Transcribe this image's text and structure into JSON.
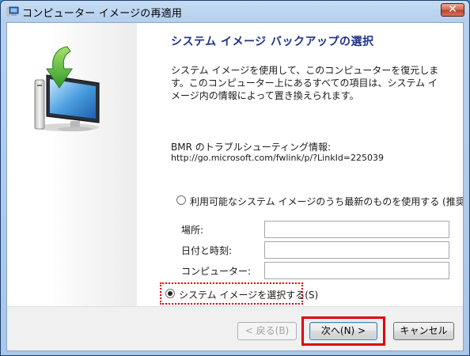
{
  "window": {
    "title": "コンピューター イメージの再適用",
    "close_glyph": "✕"
  },
  "page": {
    "heading": "システム イメージ バックアップの選択",
    "description": "システム イメージを使用して、このコンピューターを復元します。このコンピューター上にあるすべての項目は、システム イメージ内の情報によって置き換えられます。",
    "bmr_label": "BMR のトラブルシューティング情報:",
    "bmr_link": "http://go.microsoft.com/fwlink/p/?LinkId=225039"
  },
  "options": {
    "latest_label": "利用可能なシステム イメージのうち最新のものを使用する (推奨)(U)",
    "latest_selected": false,
    "select_label": "システム イメージを選択する(S)",
    "select_selected": true
  },
  "fields": [
    {
      "label": "場所:",
      "value": ""
    },
    {
      "label": "日付と時刻:",
      "value": ""
    },
    {
      "label": "コンピューター:",
      "value": ""
    }
  ],
  "buttons": {
    "back": "< 戻る(B)",
    "next": "次へ(N) >",
    "cancel": "キャンセル"
  },
  "icons": {
    "title": "restore-image-icon",
    "logo": "computer-restore-arrow-icon"
  },
  "colors": {
    "heading": "#1e3287",
    "highlight": "#e00000"
  }
}
